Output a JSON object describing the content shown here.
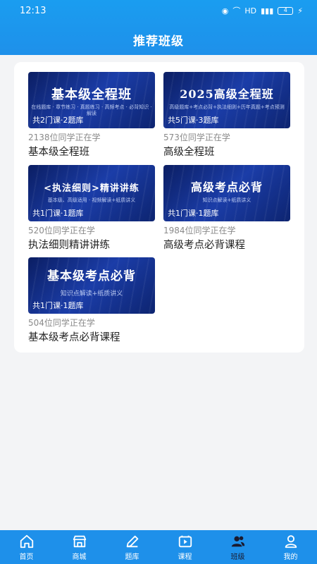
{
  "status": {
    "time": "12:13",
    "hd": "HD",
    "battery": "4"
  },
  "header": {
    "title": "推荐班级"
  },
  "cards": [
    {
      "thumb_title": "基本级全程班",
      "thumb_sub": "在线题库 · 章节练习 · 真题练习 · 高频考点 · 必背知识 · 解读",
      "meta": "共2门课·2题库",
      "learners": "2138位同学正在学",
      "name": "基本级全程班"
    },
    {
      "thumb_title": "2025高级全程班",
      "thumb_sub": "高级题库+考点必背+执法细则+历年真题+考点预测",
      "meta": "共5门课·3题库",
      "learners": "573位同学正在学",
      "name": "高级全程班"
    },
    {
      "thumb_title": "<执法细则>精讲讲练",
      "thumb_sub": "基本级、高级适用 · 视频解读+纸质讲义",
      "meta": "共1门课·1题库",
      "learners": "520位同学正在学",
      "name": "执法细则精讲讲练"
    },
    {
      "thumb_title": "高级考点必背",
      "thumb_sub": "知识点解读+纸质讲义",
      "meta": "共1门课·1题库",
      "learners": "1984位同学正在学",
      "name": "高级考点必背课程"
    },
    {
      "thumb_title": "基本级考点必背",
      "thumb_sub": "知识点解读+纸质讲义",
      "meta": "共1门课·1题库",
      "learners": "504位同学正在学",
      "name": "基本级考点必背课程"
    }
  ],
  "tabs": [
    {
      "label": "首页",
      "icon": "home-icon"
    },
    {
      "label": "商城",
      "icon": "store-icon"
    },
    {
      "label": "题库",
      "icon": "pencil-icon"
    },
    {
      "label": "课程",
      "icon": "video-icon"
    },
    {
      "label": "班级",
      "icon": "users-icon",
      "active": true
    },
    {
      "label": "我的",
      "icon": "person-icon"
    }
  ]
}
